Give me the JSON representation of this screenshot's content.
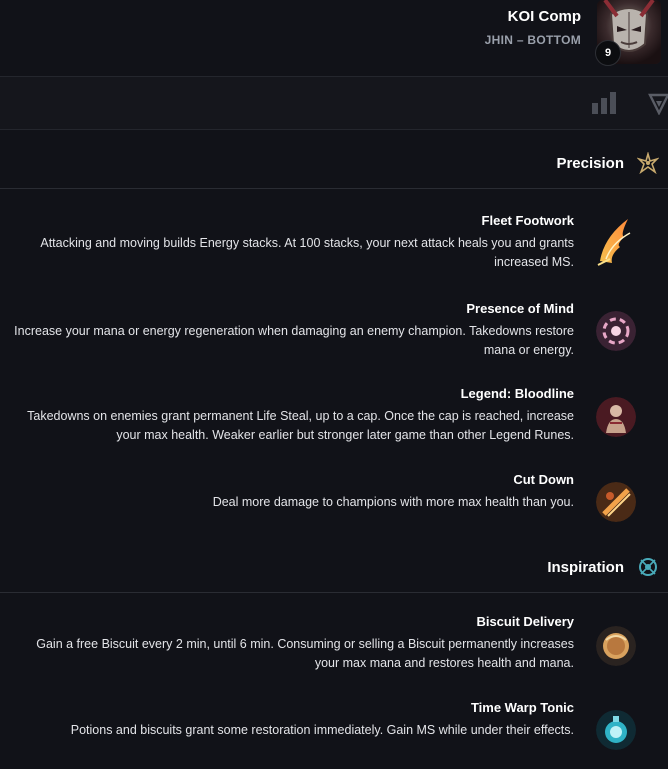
{
  "header": {
    "title": "KOI Comp",
    "subtitle": "JHIN – BOTTOM",
    "level": "9",
    "portrait_icon": "jhin-portrait"
  },
  "toolbar": {
    "icons": [
      "bar-chart-icon",
      "rune-tree-icon"
    ]
  },
  "colors": {
    "background": "#111218",
    "toolbar": "#15161c",
    "divider": "#24262d",
    "precision": "#c8aa6e",
    "inspiration": "#49aab9"
  },
  "trees": [
    {
      "name": "Precision",
      "icon": "precision-icon",
      "runes": [
        {
          "title": "Fleet Footwork",
          "desc": "Attacking and moving builds Energy stacks. At 100 stacks, your next attack heals you and grants increased MS.",
          "icon": "fleet-footwork-icon"
        },
        {
          "title": "Presence of Mind",
          "desc": "Increase your mana or energy regeneration when damaging an enemy champion. Takedowns restore mana or energy.",
          "icon": "presence-of-mind-icon"
        },
        {
          "title": "Legend: Bloodline",
          "desc": "Takedowns on enemies grant permanent Life Steal, up to a cap. Once the cap is reached, increase your max health. Weaker earlier but stronger later game than other Legend Runes.",
          "icon": "legend-bloodline-icon"
        },
        {
          "title": "Cut Down",
          "desc": "Deal more damage to champions with more max health than you.",
          "icon": "cut-down-icon"
        }
      ]
    },
    {
      "name": "Inspiration",
      "icon": "inspiration-icon",
      "runes": [
        {
          "title": "Biscuit Delivery",
          "desc": "Gain a free Biscuit every 2 min, until 6 min. Consuming or selling a Biscuit permanently increases your max mana and restores health and mana.",
          "icon": "biscuit-delivery-icon"
        },
        {
          "title": "Time Warp Tonic",
          "desc": "Potions and biscuits grant some restoration immediately. Gain MS while under their effects.",
          "icon": "time-warp-tonic-icon"
        }
      ]
    }
  ]
}
